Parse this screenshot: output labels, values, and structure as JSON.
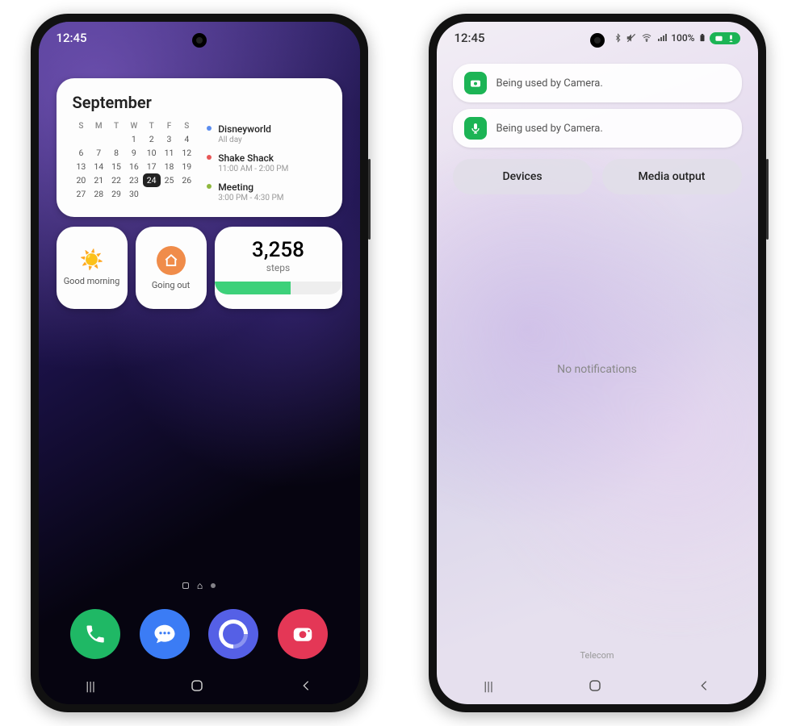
{
  "left": {
    "time": "12:45",
    "calendar": {
      "month": "September",
      "dow": [
        "S",
        "M",
        "T",
        "W",
        "T",
        "F",
        "S"
      ],
      "weeks": [
        [
          "",
          "",
          "",
          "1",
          "2",
          "3",
          "4"
        ],
        [
          "6",
          "7",
          "8",
          "9",
          "10",
          "11",
          "12"
        ],
        [
          "13",
          "14",
          "15",
          "16",
          "17",
          "18",
          "19"
        ],
        [
          "20",
          "21",
          "22",
          "23",
          "24",
          "25",
          "26"
        ],
        [
          "27",
          "28",
          "29",
          "30",
          "",
          "",
          ""
        ]
      ],
      "today": "24",
      "events": [
        {
          "title": "Disneyworld",
          "time": "All day"
        },
        {
          "title": "Shake Shack",
          "time": "11:00 AM - 2:00 PM"
        },
        {
          "title": "Meeting",
          "time": "3:00 PM - 4:30 PM"
        }
      ]
    },
    "routine1": "Good morning",
    "routine2": "Going out",
    "steps": {
      "value": "3,258",
      "label": "steps",
      "progress": 60
    },
    "dock": [
      "phone",
      "messages",
      "browser",
      "camera"
    ]
  },
  "right": {
    "time": "12:45",
    "battery": "100%",
    "notif1": "Being used by Camera.",
    "notif2": "Being used by Camera.",
    "qs1": "Devices",
    "qs2": "Media output",
    "empty": "No notifications",
    "carrier": "Telecom"
  }
}
